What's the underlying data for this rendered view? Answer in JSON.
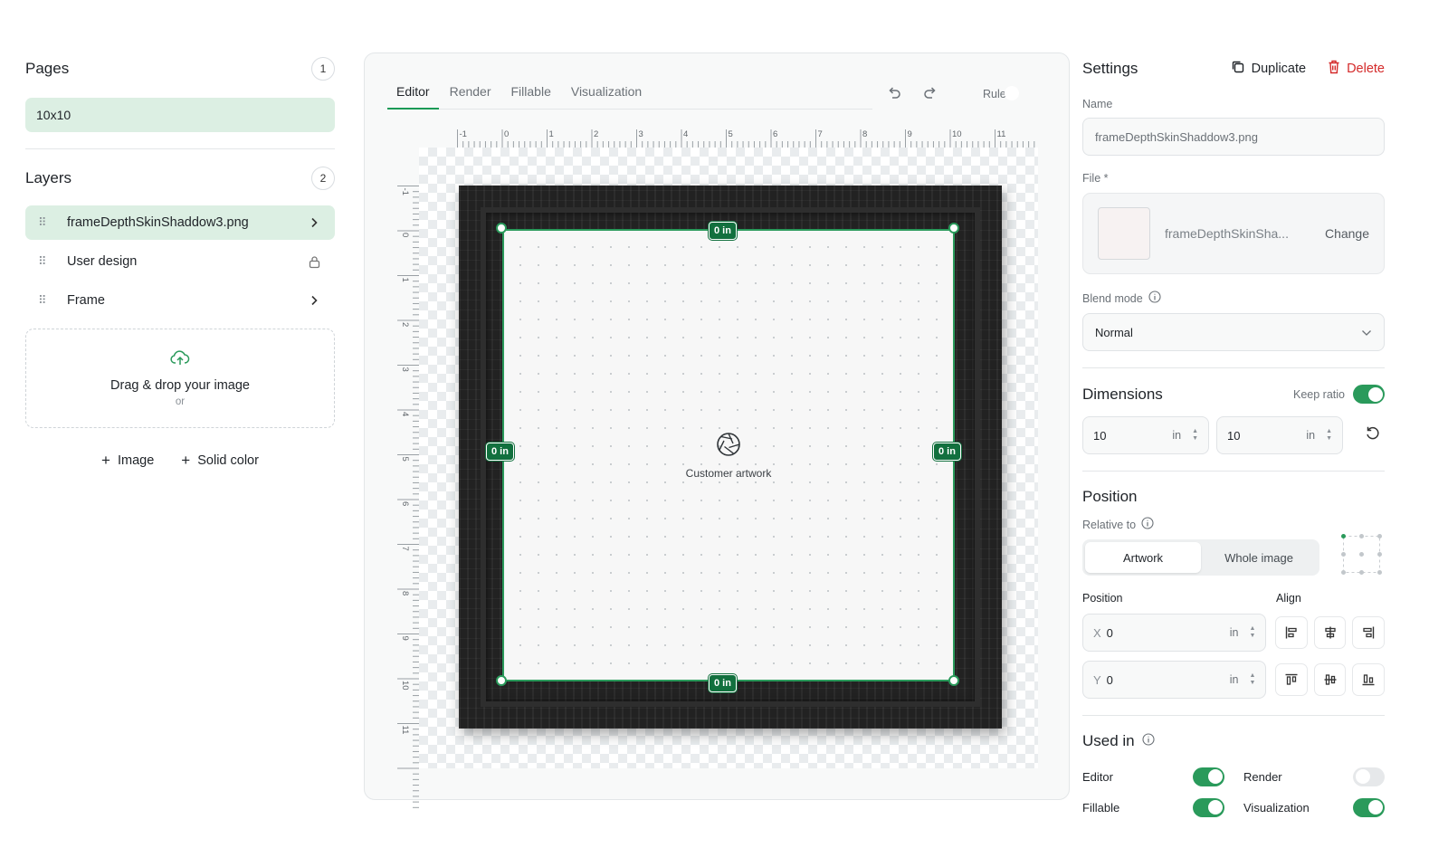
{
  "left": {
    "pages_title": "Pages",
    "pages_count": "1",
    "pages": [
      {
        "label": "10x10"
      }
    ],
    "layers_title": "Layers",
    "layers_count": "2",
    "layers": [
      {
        "label": "frameDepthSkinShaddow3.png",
        "trail": "chevron-right-icon"
      },
      {
        "label": "User design",
        "trail": "lock-icon"
      },
      {
        "label": "Frame",
        "trail": "chevron-right-icon"
      }
    ],
    "dropzone_title": "Drag & drop your image",
    "dropzone_or": "or",
    "add_image_label": "Image",
    "add_solid_label": "Solid color"
  },
  "editor": {
    "tabs": [
      {
        "label": "Editor",
        "active": true
      },
      {
        "label": "Render",
        "active": false
      },
      {
        "label": "Fillable",
        "active": false
      },
      {
        "label": "Visualization",
        "active": false
      }
    ],
    "rulers_label": "Rulers",
    "rulers_on": true,
    "ruler_ticks": [
      "-1",
      "0",
      "1",
      "2",
      "3",
      "4",
      "5",
      "6",
      "7",
      "8",
      "9",
      "10",
      "11"
    ],
    "gap_top": "0 in",
    "gap_bottom": "0 in",
    "gap_left": "0 in",
    "gap_right": "0 in",
    "artwork_label": "Customer artwork"
  },
  "settings": {
    "title": "Settings",
    "duplicate_label": "Duplicate",
    "delete_label": "Delete",
    "name_label": "Name",
    "name_value": "frameDepthSkinShaddow3.png",
    "file_label": "File *",
    "file_name": "frameDepthSkinSha...",
    "change_label": "Change",
    "blend_label": "Blend mode",
    "blend_value": "Normal",
    "dimensions_title": "Dimensions",
    "keep_ratio_label": "Keep ratio",
    "keep_ratio_on": true,
    "width_value": "10",
    "height_value": "10",
    "unit": "in",
    "position_title": "Position",
    "relative_label": "Relative to",
    "relative_options": [
      {
        "label": "Artwork",
        "selected": true
      },
      {
        "label": "Whole image",
        "selected": false
      }
    ],
    "position_sub": "Position",
    "align_sub": "Align",
    "x_axis": "X",
    "x_value": "0",
    "y_axis": "Y",
    "y_value": "0",
    "used_in_title": "Used in",
    "used_in": [
      {
        "label": "Editor",
        "on": true
      },
      {
        "label": "Render",
        "on": false
      },
      {
        "label": "Fillable",
        "on": true
      },
      {
        "label": "Visualization",
        "on": true
      }
    ]
  },
  "colors": {
    "accent": "#2a9a5b",
    "delete": "#d42a2a",
    "active_bg": "#dcefe3"
  }
}
